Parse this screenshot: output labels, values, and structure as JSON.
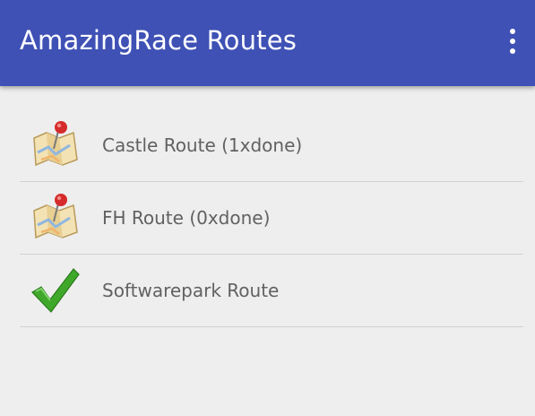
{
  "toolbar": {
    "title": "AmazingRace Routes",
    "overflow_icon": "more-vert-icon",
    "color": "#3f51b5"
  },
  "routes": [
    {
      "label": "Castle Route (1xdone)",
      "icon": "map-pin-icon"
    },
    {
      "label": "FH Route (0xdone)",
      "icon": "map-pin-icon"
    },
    {
      "label": "Softwarepark Route",
      "icon": "checkmark-icon"
    }
  ]
}
